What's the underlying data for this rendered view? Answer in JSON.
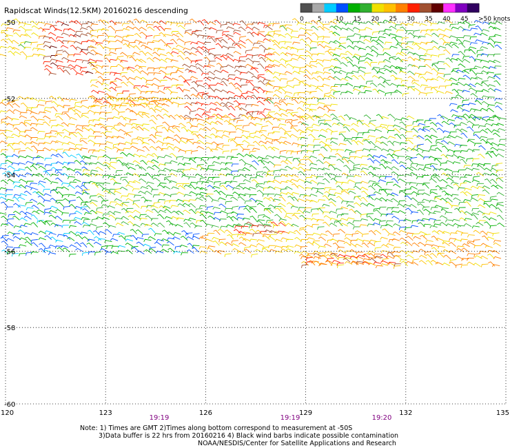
{
  "title": "Rapidscat Winds(12.5KM) 20160216 descending",
  "legend": {
    "colors": [
      "#505050",
      "#a8a8a8",
      "#00ccff",
      "#0050ff",
      "#00b000",
      "#30b030",
      "#f0e000",
      "#ffc000",
      "#ff8000",
      "#ff2000",
      "#a05030",
      "#600000",
      "#ff30ff",
      "#8000c0",
      "#300060"
    ],
    "labels": [
      "0",
      "5",
      "10",
      "15",
      "20",
      "25",
      "30",
      "35",
      "40",
      "45",
      ">50 knots"
    ]
  },
  "axes": {
    "lon_labels": [
      "120",
      "123",
      "126",
      "129",
      "132",
      "135"
    ],
    "lat_labels": [
      "-50",
      "-52",
      "-54",
      "-56",
      "-58",
      "-60"
    ]
  },
  "time_labels": [
    "19:19",
    "19:19",
    "19:20"
  ],
  "notes": [
    "Note: 1) Times are GMT 2)Times along bottom correspond to measurement at -50S",
    "3)Data buffer is 22 hrs from 20160216 4) Black wind barbs indicate possible contamination",
    "NOAA/NESDIS/Center for Satellite Applications and Research"
  ],
  "regions": [
    {
      "lon": [
        120,
        121.3
      ],
      "lat": [
        -50,
        -51
      ],
      "speed": 22
    },
    {
      "lon": [
        121.3,
        122.7
      ],
      "lat": [
        -50,
        -51.5
      ],
      "speed": 32
    },
    {
      "lon": [
        122.7,
        125.5
      ],
      "lat": [
        -50,
        -52.2
      ],
      "speed": 25
    },
    {
      "lon": [
        125.5,
        128
      ],
      "lat": [
        -50,
        -52.5
      ],
      "speed": 31
    },
    {
      "lon": [
        128,
        130
      ],
      "lat": [
        -50,
        -52.5
      ],
      "speed": 22
    },
    {
      "lon": [
        130,
        132
      ],
      "lat": [
        -50,
        -52
      ],
      "speed": 16
    },
    {
      "lon": [
        132,
        133.5
      ],
      "lat": [
        -50,
        -52
      ],
      "speed": 20
    },
    {
      "lon": [
        133.5,
        135
      ],
      "lat": [
        -50,
        -52.5
      ],
      "speed": 14
    },
    {
      "lon": [
        120,
        125
      ],
      "lat": [
        -52,
        -53.5
      ],
      "speed": 24
    },
    {
      "lon": [
        125,
        129
      ],
      "lat": [
        -52.5,
        -53.5
      ],
      "speed": 24
    },
    {
      "lon": [
        129,
        132.5
      ],
      "lat": [
        -52.5,
        -53.5
      ],
      "speed": 18
    },
    {
      "lon": [
        132.5,
        135
      ],
      "lat": [
        -52.5,
        -53.5
      ],
      "speed": 13
    },
    {
      "lon": [
        120,
        122.5
      ],
      "lat": [
        -53.5,
        -55.5
      ],
      "speed": 11
    },
    {
      "lon": [
        122.5,
        126
      ],
      "lat": [
        -53.5,
        -55.5
      ],
      "speed": 17
    },
    {
      "lon": [
        126,
        128
      ],
      "lat": [
        -53.5,
        -55.5
      ],
      "speed": 15
    },
    {
      "lon": [
        128,
        131
      ],
      "lat": [
        -53.5,
        -55.5
      ],
      "speed": 19
    },
    {
      "lon": [
        131,
        133
      ],
      "lat": [
        -53.5,
        -55.5
      ],
      "speed": 14
    },
    {
      "lon": [
        133,
        135
      ],
      "lat": [
        -53.5,
        -55.5
      ],
      "speed": 16
    },
    {
      "lon": [
        120,
        126
      ],
      "lat": [
        -55.5,
        -56.1
      ],
      "speed": 11
    },
    {
      "lon": [
        126,
        129
      ],
      "lat": [
        -55.5,
        -56.1
      ],
      "speed": 23
    },
    {
      "lon": [
        129,
        135
      ],
      "lat": [
        -55.5,
        -56.4
      ],
      "speed": 24
    },
    {
      "lon": [
        127,
        128.5
      ],
      "lat": [
        -55.3,
        -55.6
      ],
      "speed": 31
    },
    {
      "lon": [
        129,
        132
      ],
      "lat": [
        -56.1,
        -56.4
      ],
      "speed": 30
    }
  ]
}
